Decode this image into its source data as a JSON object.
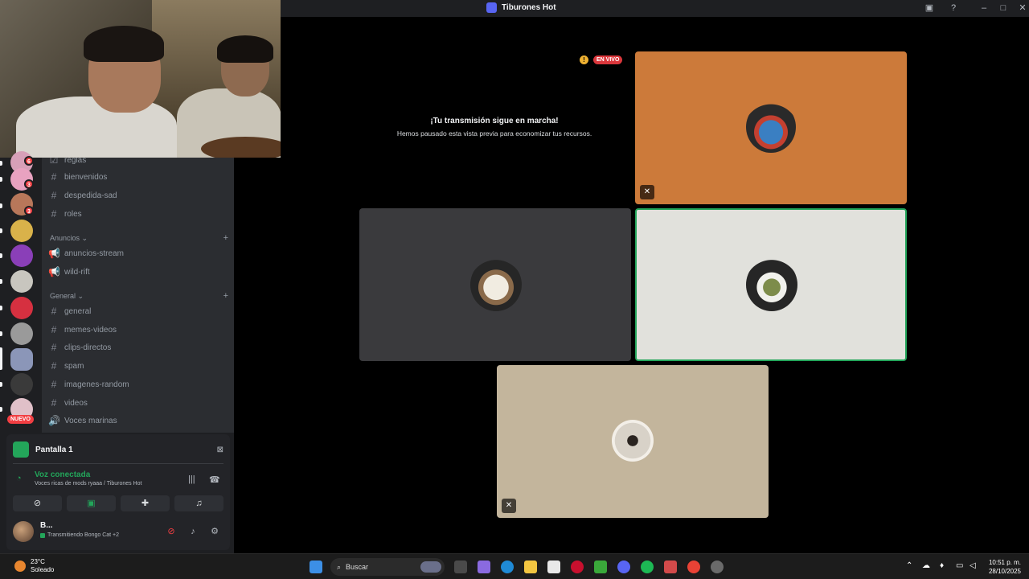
{
  "window": {
    "title": "Tiburones Hot"
  },
  "server_rail": {
    "badges": [
      "6",
      "3",
      "3"
    ],
    "new_label": "NUEVO"
  },
  "channels": {
    "items": [
      {
        "type": "text",
        "label": "reglas"
      },
      {
        "type": "text",
        "label": "bienvenidos"
      },
      {
        "type": "text",
        "label": "despedida-sad"
      },
      {
        "type": "text",
        "label": "roles"
      }
    ],
    "categories": [
      {
        "name": "Anuncios",
        "items": [
          {
            "type": "announce",
            "label": "anuncios-stream"
          },
          {
            "type": "announce",
            "label": "wild-rift"
          }
        ]
      },
      {
        "name": "General",
        "items": [
          {
            "type": "text",
            "label": "general"
          },
          {
            "type": "text",
            "label": "memes-videos"
          },
          {
            "type": "text",
            "label": "clips-directos"
          },
          {
            "type": "text",
            "label": "spam"
          },
          {
            "type": "text",
            "label": "imagenes-random"
          },
          {
            "type": "text",
            "label": "videos"
          },
          {
            "type": "voice",
            "label": "Voces marinas"
          }
        ]
      }
    ]
  },
  "stream_panel": {
    "screen_label": "Pantalla 1",
    "voice_status": "Voz conectada",
    "voice_channel": "Voces ricas de mods ryaaa / Tiburones Hot"
  },
  "user": {
    "name": "B...",
    "status": "Transmitiendo Bongo Cat +2"
  },
  "stage": {
    "live_label": "EN VIVO",
    "paused_title": "¡Tu transmisión sigue en marcha!",
    "paused_subtitle": "Hemos pausado esta vista previa para economizar tus recursos."
  },
  "colors": {
    "tile_orange": "#cc7a3a",
    "tile_dark": "#3a3a3d",
    "tile_light": "#e1e1dc",
    "tile_beige": "#c3b59c",
    "speaking_outline": "#23a55a"
  },
  "taskbar": {
    "weather_temp": "23°C",
    "weather_desc": "Soleado",
    "search_placeholder": "Buscar",
    "time": "10:51 p. m.",
    "date": "28/10/2025"
  }
}
